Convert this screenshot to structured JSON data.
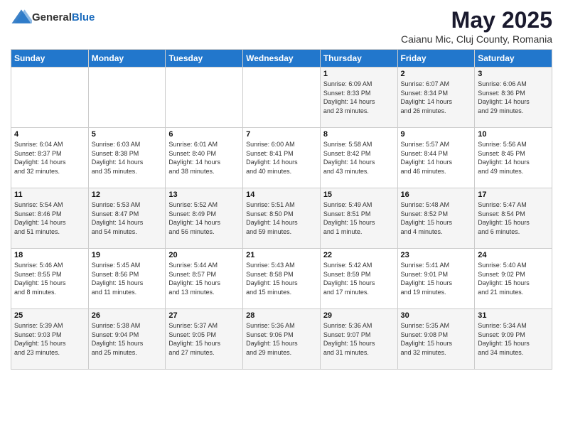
{
  "header": {
    "logo_general": "General",
    "logo_blue": "Blue",
    "month_title": "May 2025",
    "subtitle": "Caianu Mic, Cluj County, Romania"
  },
  "days_of_week": [
    "Sunday",
    "Monday",
    "Tuesday",
    "Wednesday",
    "Thursday",
    "Friday",
    "Saturday"
  ],
  "weeks": [
    [
      {
        "num": "",
        "info": ""
      },
      {
        "num": "",
        "info": ""
      },
      {
        "num": "",
        "info": ""
      },
      {
        "num": "",
        "info": ""
      },
      {
        "num": "1",
        "info": "Sunrise: 6:09 AM\nSunset: 8:33 PM\nDaylight: 14 hours\nand 23 minutes."
      },
      {
        "num": "2",
        "info": "Sunrise: 6:07 AM\nSunset: 8:34 PM\nDaylight: 14 hours\nand 26 minutes."
      },
      {
        "num": "3",
        "info": "Sunrise: 6:06 AM\nSunset: 8:36 PM\nDaylight: 14 hours\nand 29 minutes."
      }
    ],
    [
      {
        "num": "4",
        "info": "Sunrise: 6:04 AM\nSunset: 8:37 PM\nDaylight: 14 hours\nand 32 minutes."
      },
      {
        "num": "5",
        "info": "Sunrise: 6:03 AM\nSunset: 8:38 PM\nDaylight: 14 hours\nand 35 minutes."
      },
      {
        "num": "6",
        "info": "Sunrise: 6:01 AM\nSunset: 8:40 PM\nDaylight: 14 hours\nand 38 minutes."
      },
      {
        "num": "7",
        "info": "Sunrise: 6:00 AM\nSunset: 8:41 PM\nDaylight: 14 hours\nand 40 minutes."
      },
      {
        "num": "8",
        "info": "Sunrise: 5:58 AM\nSunset: 8:42 PM\nDaylight: 14 hours\nand 43 minutes."
      },
      {
        "num": "9",
        "info": "Sunrise: 5:57 AM\nSunset: 8:44 PM\nDaylight: 14 hours\nand 46 minutes."
      },
      {
        "num": "10",
        "info": "Sunrise: 5:56 AM\nSunset: 8:45 PM\nDaylight: 14 hours\nand 49 minutes."
      }
    ],
    [
      {
        "num": "11",
        "info": "Sunrise: 5:54 AM\nSunset: 8:46 PM\nDaylight: 14 hours\nand 51 minutes."
      },
      {
        "num": "12",
        "info": "Sunrise: 5:53 AM\nSunset: 8:47 PM\nDaylight: 14 hours\nand 54 minutes."
      },
      {
        "num": "13",
        "info": "Sunrise: 5:52 AM\nSunset: 8:49 PM\nDaylight: 14 hours\nand 56 minutes."
      },
      {
        "num": "14",
        "info": "Sunrise: 5:51 AM\nSunset: 8:50 PM\nDaylight: 14 hours\nand 59 minutes."
      },
      {
        "num": "15",
        "info": "Sunrise: 5:49 AM\nSunset: 8:51 PM\nDaylight: 15 hours\nand 1 minute."
      },
      {
        "num": "16",
        "info": "Sunrise: 5:48 AM\nSunset: 8:52 PM\nDaylight: 15 hours\nand 4 minutes."
      },
      {
        "num": "17",
        "info": "Sunrise: 5:47 AM\nSunset: 8:54 PM\nDaylight: 15 hours\nand 6 minutes."
      }
    ],
    [
      {
        "num": "18",
        "info": "Sunrise: 5:46 AM\nSunset: 8:55 PM\nDaylight: 15 hours\nand 8 minutes."
      },
      {
        "num": "19",
        "info": "Sunrise: 5:45 AM\nSunset: 8:56 PM\nDaylight: 15 hours\nand 11 minutes."
      },
      {
        "num": "20",
        "info": "Sunrise: 5:44 AM\nSunset: 8:57 PM\nDaylight: 15 hours\nand 13 minutes."
      },
      {
        "num": "21",
        "info": "Sunrise: 5:43 AM\nSunset: 8:58 PM\nDaylight: 15 hours\nand 15 minutes."
      },
      {
        "num": "22",
        "info": "Sunrise: 5:42 AM\nSunset: 8:59 PM\nDaylight: 15 hours\nand 17 minutes."
      },
      {
        "num": "23",
        "info": "Sunrise: 5:41 AM\nSunset: 9:01 PM\nDaylight: 15 hours\nand 19 minutes."
      },
      {
        "num": "24",
        "info": "Sunrise: 5:40 AM\nSunset: 9:02 PM\nDaylight: 15 hours\nand 21 minutes."
      }
    ],
    [
      {
        "num": "25",
        "info": "Sunrise: 5:39 AM\nSunset: 9:03 PM\nDaylight: 15 hours\nand 23 minutes."
      },
      {
        "num": "26",
        "info": "Sunrise: 5:38 AM\nSunset: 9:04 PM\nDaylight: 15 hours\nand 25 minutes."
      },
      {
        "num": "27",
        "info": "Sunrise: 5:37 AM\nSunset: 9:05 PM\nDaylight: 15 hours\nand 27 minutes."
      },
      {
        "num": "28",
        "info": "Sunrise: 5:36 AM\nSunset: 9:06 PM\nDaylight: 15 hours\nand 29 minutes."
      },
      {
        "num": "29",
        "info": "Sunrise: 5:36 AM\nSunset: 9:07 PM\nDaylight: 15 hours\nand 31 minutes."
      },
      {
        "num": "30",
        "info": "Sunrise: 5:35 AM\nSunset: 9:08 PM\nDaylight: 15 hours\nand 32 minutes."
      },
      {
        "num": "31",
        "info": "Sunrise: 5:34 AM\nSunset: 9:09 PM\nDaylight: 15 hours\nand 34 minutes."
      }
    ]
  ]
}
